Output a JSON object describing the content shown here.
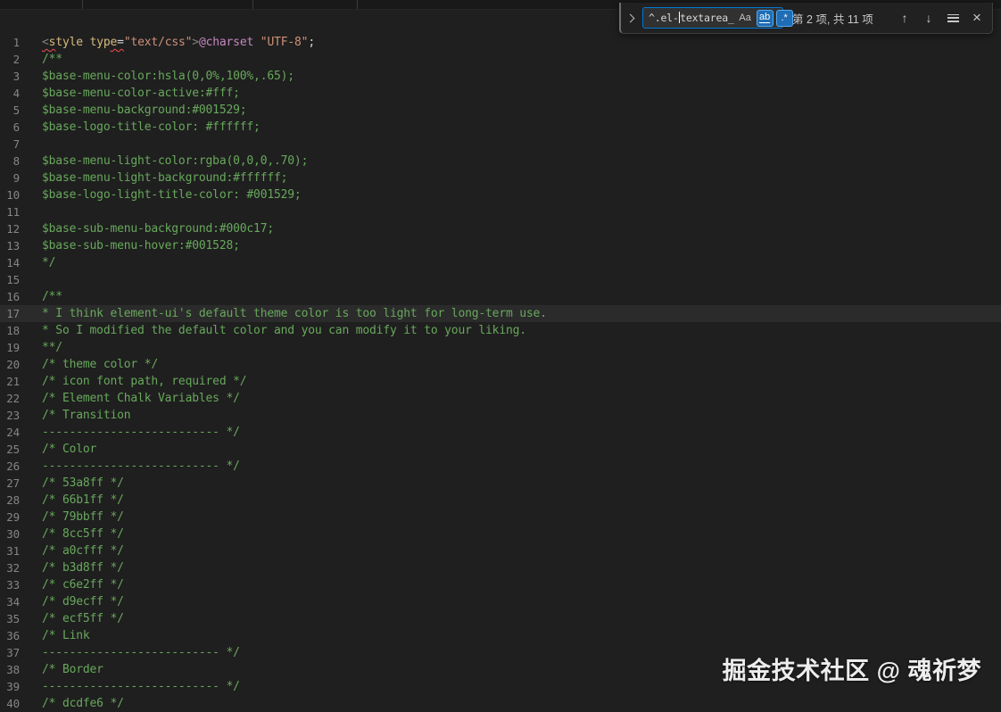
{
  "find_widget": {
    "query": "^.el-textarea_",
    "cursor_index": 5,
    "match_case_label": "Aa",
    "whole_word_label": "ab",
    "regex_label": ".*",
    "whole_word_active": true,
    "regex_active": true,
    "match_case_active": false,
    "results_text": "第 2 项, 共 11 项",
    "icons": {
      "prev": "↑",
      "next": "↓",
      "close": "×"
    },
    "accent_color": "#0078d4",
    "option_active_bg": "#1f6db5",
    "option_active_border": "#55aaf0"
  },
  "watermark": "掘金技术社区 @ 魂祈梦",
  "editor": {
    "current_line_bg": "rgba(255,255,255,0.055)",
    "colors": {
      "comment": "#68a85c",
      "selector": "#d7ba7d",
      "string": "#ce9178",
      "plain": "#d4d4d4",
      "bracket": "#808080",
      "at_rule": "#c586c0",
      "error_squiggle": "#f14c4c"
    },
    "lines": [
      {
        "n": 1,
        "tokens": [
          {
            "t": "<",
            "c": "bracket",
            "sq": true
          },
          {
            "t": "s",
            "c": "selector",
            "sq": true
          },
          {
            "t": "tyle",
            "c": "selector"
          },
          {
            "t": " ",
            "c": "plain"
          },
          {
            "t": "typ",
            "c": "selector"
          },
          {
            "t": "e",
            "c": "selector",
            "sq": true
          },
          {
            "t": "=",
            "c": "plain",
            "sq": true
          },
          {
            "t": "\"text/css\"",
            "c": "string"
          },
          {
            "t": ">",
            "c": "bracket"
          },
          {
            "t": "@charset",
            "c": "at_rule"
          },
          {
            "t": " ",
            "c": "plain"
          },
          {
            "t": "\"UTF-8\"",
            "c": "string"
          },
          {
            "t": ";",
            "c": "plain"
          }
        ]
      },
      {
        "n": 2,
        "tokens": [
          {
            "t": "/**",
            "c": "comment"
          }
        ]
      },
      {
        "n": 3,
        "tokens": [
          {
            "t": "$base-menu-color:hsla(0,0%,100%,.65);",
            "c": "comment"
          }
        ]
      },
      {
        "n": 4,
        "tokens": [
          {
            "t": "$base-menu-color-active:#fff;",
            "c": "comment"
          }
        ]
      },
      {
        "n": 5,
        "tokens": [
          {
            "t": "$base-menu-background:#001529;",
            "c": "comment"
          }
        ]
      },
      {
        "n": 6,
        "tokens": [
          {
            "t": "$base-logo-title-color: #ffffff;",
            "c": "comment"
          }
        ]
      },
      {
        "n": 7,
        "tokens": []
      },
      {
        "n": 8,
        "tokens": [
          {
            "t": "$base-menu-light-color:rgba(0,0,0,.70);",
            "c": "comment"
          }
        ]
      },
      {
        "n": 9,
        "tokens": [
          {
            "t": "$base-menu-light-background:#ffffff;",
            "c": "comment"
          }
        ]
      },
      {
        "n": 10,
        "tokens": [
          {
            "t": "$base-logo-light-title-color: #001529;",
            "c": "comment"
          }
        ]
      },
      {
        "n": 11,
        "tokens": []
      },
      {
        "n": 12,
        "tokens": [
          {
            "t": "$base-sub-menu-background:#000c17;",
            "c": "comment"
          }
        ]
      },
      {
        "n": 13,
        "tokens": [
          {
            "t": "$base-sub-menu-hover:#001528;",
            "c": "comment"
          }
        ]
      },
      {
        "n": 14,
        "tokens": [
          {
            "t": "*/",
            "c": "comment"
          }
        ]
      },
      {
        "n": 15,
        "tokens": []
      },
      {
        "n": 16,
        "tokens": [
          {
            "t": "/**",
            "c": "comment"
          }
        ]
      },
      {
        "n": 17,
        "hl": true,
        "tokens": [
          {
            "t": "* I think element-ui's default theme color is too light for long-term use.",
            "c": "comment"
          }
        ]
      },
      {
        "n": 18,
        "tokens": [
          {
            "t": "* So I modified the default color and you can modify it to your liking.",
            "c": "comment"
          }
        ]
      },
      {
        "n": 19,
        "tokens": [
          {
            "t": "**/",
            "c": "comment"
          }
        ]
      },
      {
        "n": 20,
        "tokens": [
          {
            "t": "/* theme color */",
            "c": "comment"
          }
        ]
      },
      {
        "n": 21,
        "tokens": [
          {
            "t": "/* icon font path, required */",
            "c": "comment"
          }
        ]
      },
      {
        "n": 22,
        "tokens": [
          {
            "t": "/* Element Chalk Variables */",
            "c": "comment"
          }
        ]
      },
      {
        "n": 23,
        "tokens": [
          {
            "t": "/* Transition",
            "c": "comment"
          }
        ]
      },
      {
        "n": 24,
        "tokens": [
          {
            "t": "-------------------------- */",
            "c": "comment"
          }
        ]
      },
      {
        "n": 25,
        "tokens": [
          {
            "t": "/* Color",
            "c": "comment"
          }
        ]
      },
      {
        "n": 26,
        "tokens": [
          {
            "t": "-------------------------- */",
            "c": "comment"
          }
        ]
      },
      {
        "n": 27,
        "tokens": [
          {
            "t": "/* 53a8ff */",
            "c": "comment"
          }
        ]
      },
      {
        "n": 28,
        "tokens": [
          {
            "t": "/* 66b1ff */",
            "c": "comment"
          }
        ]
      },
      {
        "n": 29,
        "tokens": [
          {
            "t": "/* 79bbff */",
            "c": "comment"
          }
        ]
      },
      {
        "n": 30,
        "tokens": [
          {
            "t": "/* 8cc5ff */",
            "c": "comment"
          }
        ]
      },
      {
        "n": 31,
        "tokens": [
          {
            "t": "/* a0cfff */",
            "c": "comment"
          }
        ]
      },
      {
        "n": 32,
        "tokens": [
          {
            "t": "/* b3d8ff */",
            "c": "comment"
          }
        ]
      },
      {
        "n": 33,
        "tokens": [
          {
            "t": "/* c6e2ff */",
            "c": "comment"
          }
        ]
      },
      {
        "n": 34,
        "tokens": [
          {
            "t": "/* d9ecff */",
            "c": "comment"
          }
        ]
      },
      {
        "n": 35,
        "tokens": [
          {
            "t": "/* ecf5ff */",
            "c": "comment"
          }
        ]
      },
      {
        "n": 36,
        "tokens": [
          {
            "t": "/* Link",
            "c": "comment"
          }
        ]
      },
      {
        "n": 37,
        "tokens": [
          {
            "t": "-------------------------- */",
            "c": "comment"
          }
        ]
      },
      {
        "n": 38,
        "tokens": [
          {
            "t": "/* Border",
            "c": "comment"
          }
        ]
      },
      {
        "n": 39,
        "tokens": [
          {
            "t": "-------------------------- */",
            "c": "comment"
          }
        ]
      },
      {
        "n": 40,
        "tokens": [
          {
            "t": "/* dcdfe6 */",
            "c": "comment"
          }
        ]
      }
    ]
  }
}
